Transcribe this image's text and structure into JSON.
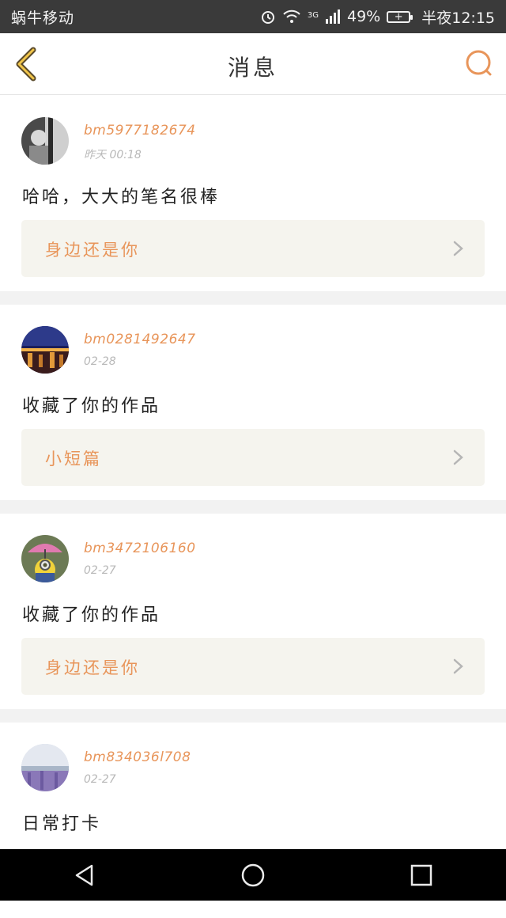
{
  "status_bar": {
    "carrier": "蜗牛移动",
    "network": "3G",
    "battery_percent": "49%",
    "time": "半夜12:15",
    "icons": [
      "alarm-icon",
      "wifi-icon",
      "signal-icon",
      "battery-icon"
    ]
  },
  "header": {
    "title": "消息",
    "back_icon": "chevron-left-icon",
    "search_icon": "search-icon",
    "accent_color": "#e8955a"
  },
  "messages": [
    {
      "username": "bm5977182674",
      "time": "昨天 00:18",
      "text": "哈哈，大大的笔名很棒",
      "work_title": "身边还是你"
    },
    {
      "username": "bm0281492647",
      "time": "02-28",
      "text": "收藏了你的作品",
      "work_title": "小短篇"
    },
    {
      "username": "bm3472106160",
      "time": "02-27",
      "text": "收藏了你的作品",
      "work_title": "身边还是你"
    },
    {
      "username": "bm834036l708",
      "time": "02-27",
      "text": "日常打卡",
      "work_title": ""
    }
  ],
  "nav": {
    "back": "triangle-back-icon",
    "home": "circle-home-icon",
    "recents": "square-recents-icon"
  }
}
